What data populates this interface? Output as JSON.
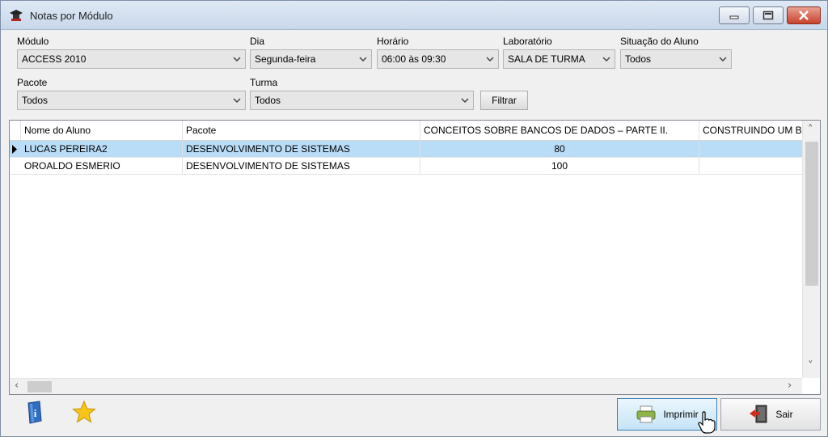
{
  "window": {
    "title": "Notas por Módulo"
  },
  "filters": {
    "modulo": {
      "label": "Módulo",
      "value": "ACCESS 2010"
    },
    "dia": {
      "label": "Dia",
      "value": "Segunda-feira"
    },
    "horario": {
      "label": "Horário",
      "value": "06:00 às 09:30"
    },
    "laboratorio": {
      "label": "Laboratório",
      "value": "SALA DE TURMA"
    },
    "situacao": {
      "label": "Situação do Aluno",
      "value": "Todos"
    },
    "pacote": {
      "label": "Pacote",
      "value": "Todos"
    },
    "turma": {
      "label": "Turma",
      "value": "Todos"
    },
    "filtrar_label": "Filtrar"
  },
  "grid": {
    "columns": [
      "Nome do Aluno",
      "Pacote",
      "CONCEITOS SOBRE BANCOS DE DADOS – PARTE II.",
      "CONSTRUINDO UM B"
    ],
    "rows": [
      {
        "nome": "LUCAS PEREIRA2",
        "pacote": "DESENVOLVIMENTO DE SISTEMAS",
        "nota": "80",
        "selected": true
      },
      {
        "nome": "OROALDO ESMERIO",
        "pacote": "DESENVOLVIMENTO DE SISTEMAS",
        "nota": "100",
        "selected": false
      }
    ]
  },
  "footer": {
    "imprimir_label": "Imprimir",
    "sair_label": "Sair"
  },
  "icons": {
    "app": "graduation-cap-icon",
    "help": "help-book-icon",
    "favorite": "star-icon",
    "print": "printer-icon",
    "exit": "exit-door-icon",
    "cursor": "hand-cursor-icon"
  },
  "colors": {
    "selected_row": "#b9dcf7",
    "close_button": "#c8412b",
    "star": "#f5c518"
  }
}
